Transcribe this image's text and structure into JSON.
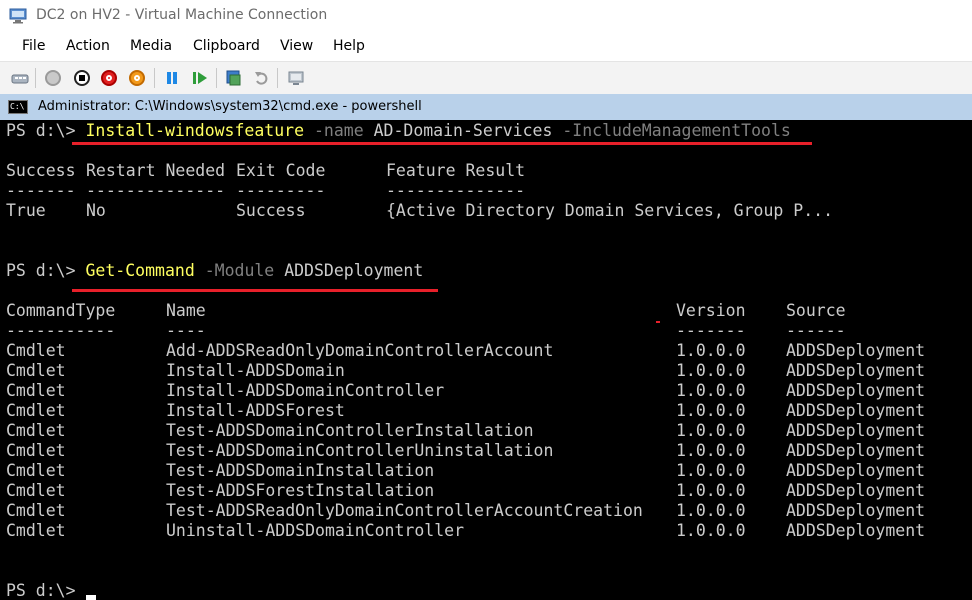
{
  "window": {
    "title": "DC2 on HV2 - Virtual Machine Connection"
  },
  "menu": [
    "File",
    "Action",
    "Media",
    "Clipboard",
    "View",
    "Help"
  ],
  "toolbar": {
    "icons": [
      "ctrl-alt-del-icon",
      "start-icon",
      "turn-off-icon",
      "shut-down-icon",
      "save-state-icon",
      "pause-icon",
      "resume-icon",
      "checkpoint-icon",
      "revert-icon",
      "enhanced-session-icon"
    ]
  },
  "cmd_window": {
    "title": "Administrator: C:\\Windows\\system32\\cmd.exe - powershell"
  },
  "console": {
    "prompt": "PS d:\\>",
    "command1": {
      "cmdlet": "Install-windowsfeature",
      "param1": "-name",
      "arg1": "AD-Domain-Services",
      "param2": "-IncludeManagementTools"
    },
    "table1": {
      "headers": [
        "Success",
        "Restart Needed",
        "Exit Code",
        "Feature Result"
      ],
      "dashes": [
        "-------",
        "--------------",
        "---------",
        "--------------"
      ],
      "row": [
        "True",
        "No",
        "Success",
        "{Active Directory Domain Services, Group P..."
      ]
    },
    "command2": {
      "cmdlet": "Get-Command",
      "param1": "-Module",
      "arg1": "ADDSDeployment"
    },
    "table2": {
      "headers": [
        "CommandType",
        "Name",
        "Version",
        "Source"
      ],
      "dashes": [
        "-----------",
        "----",
        "-------",
        "------"
      ],
      "rows": [
        [
          "Cmdlet",
          "Add-ADDSReadOnlyDomainControllerAccount",
          "1.0.0.0",
          "ADDSDeployment"
        ],
        [
          "Cmdlet",
          "Install-ADDSDomain",
          "1.0.0.0",
          "ADDSDeployment"
        ],
        [
          "Cmdlet",
          "Install-ADDSDomainController",
          "1.0.0.0",
          "ADDSDeployment"
        ],
        [
          "Cmdlet",
          "Install-ADDSForest",
          "1.0.0.0",
          "ADDSDeployment"
        ],
        [
          "Cmdlet",
          "Test-ADDSDomainControllerInstallation",
          "1.0.0.0",
          "ADDSDeployment"
        ],
        [
          "Cmdlet",
          "Test-ADDSDomainControllerUninstallation",
          "1.0.0.0",
          "ADDSDeployment"
        ],
        [
          "Cmdlet",
          "Test-ADDSDomainInstallation",
          "1.0.0.0",
          "ADDSDeployment"
        ],
        [
          "Cmdlet",
          "Test-ADDSForestInstallation",
          "1.0.0.0",
          "ADDSDeployment"
        ],
        [
          "Cmdlet",
          "Test-ADDSReadOnlyDomainControllerAccountCreation",
          "1.0.0.0",
          "ADDSDeployment"
        ],
        [
          "Cmdlet",
          "Uninstall-ADDSDomainController",
          "1.0.0.0",
          "ADDSDeployment"
        ]
      ]
    }
  },
  "colors": {
    "console_bg": "#000000",
    "console_text": "#cccccc",
    "cmdlet": "#ffff60",
    "parameter": "#808080",
    "annotation_underline": "#e8202a",
    "cmd_titlebar": "#b9d1ea"
  }
}
